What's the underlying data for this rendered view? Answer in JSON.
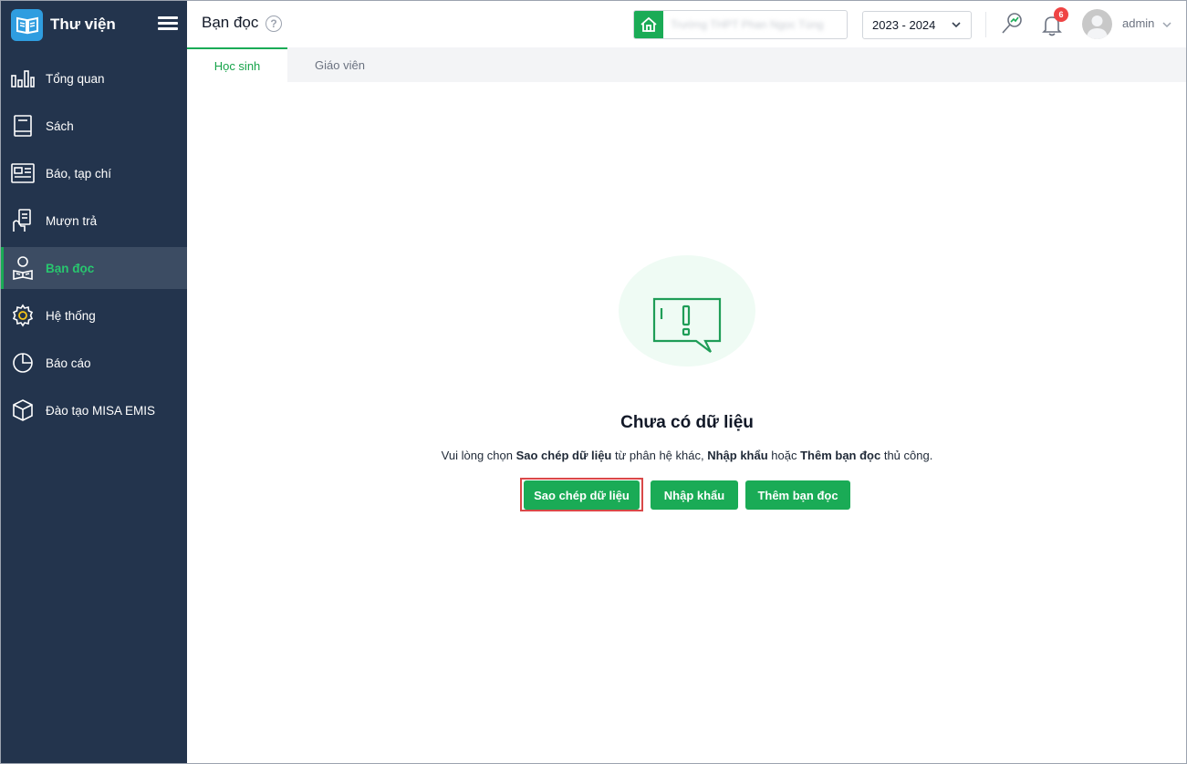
{
  "brand": {
    "title": "Thư viện"
  },
  "sidebar": {
    "items": [
      {
        "label": "Tổng quan",
        "icon": "bar-chart-icon"
      },
      {
        "label": "Sách",
        "icon": "book-icon"
      },
      {
        "label": "Báo, tạp chí",
        "icon": "newspaper-icon"
      },
      {
        "label": "Mượn trả",
        "icon": "borrow-return-icon"
      },
      {
        "label": "Bạn đọc",
        "icon": "reader-icon",
        "active": true
      },
      {
        "label": "Hệ thống",
        "icon": "gear-icon"
      },
      {
        "label": "Báo cáo",
        "icon": "pie-chart-icon"
      },
      {
        "label": "Đào tạo MISA EMIS",
        "icon": "cube-icon"
      }
    ]
  },
  "header": {
    "page_title": "Bạn đọc",
    "help": "?",
    "school_name": "Trường THPT Phan Ngọc Tùng",
    "school_year": "2023 - 2024",
    "notification_count": "6",
    "user_name": "admin"
  },
  "tabs": [
    {
      "label": "Học sinh",
      "active": true
    },
    {
      "label": "Giáo viên",
      "active": false
    }
  ],
  "empty_state": {
    "title": "Chưa có dữ liệu",
    "desc_prefix": "Vui lòng chọn ",
    "desc_bold1": "Sao chép dữ liệu",
    "desc_mid1": " từ phân hệ khác, ",
    "desc_bold2": "Nhập khẩu",
    "desc_mid2": " hoặc ",
    "desc_bold3": "Thêm bạn đọc",
    "desc_suffix": " thủ công."
  },
  "actions": {
    "copy_label": "Sao chép dữ liệu",
    "import_label": "Nhập khẩu",
    "add_label": "Thêm bạn đọc"
  },
  "colors": {
    "sidebar_bg": "#23344d",
    "accent": "#1aab56",
    "highlight_border": "#d94848",
    "badge": "#ef4444"
  }
}
